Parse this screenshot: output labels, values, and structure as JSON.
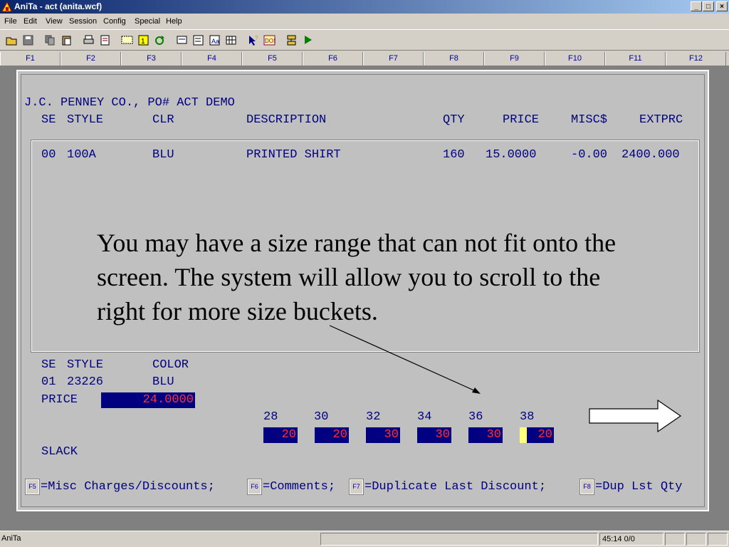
{
  "window": {
    "title": "AniTa - act (anita.wcf)",
    "controls": {
      "minimize": "_",
      "maximize": "□",
      "close": "×"
    }
  },
  "menu": [
    "File",
    "Edit",
    "View",
    "Session",
    "Config",
    "Special",
    "Help"
  ],
  "toolbar": {
    "buttons": [
      "open-icon",
      "save-icon",
      "copy-icon",
      "paste-icon",
      "print-icon",
      "print-setup-icon",
      "screen-icon",
      "capture-icon",
      "refresh-icon",
      "keyboard-icon",
      "terminal-icon",
      "font-icon",
      "grid-icon",
      "help-pointer-icon",
      "dos-icon",
      "transfer-icon",
      "run-icon"
    ]
  },
  "function_keys": [
    "F1",
    "F2",
    "F3",
    "F4",
    "F5",
    "F6",
    "F7",
    "F8",
    "F9",
    "F10",
    "F11",
    "F12"
  ],
  "terminal": {
    "header_line": "J.C. PENNEY CO., PO# ACT DEMO",
    "columns": {
      "se": "SE",
      "style": "STYLE",
      "clr": "CLR",
      "description": "DESCRIPTION",
      "qty": "QTY",
      "price": "PRICE",
      "misc": "MISC$",
      "extprc": "EXTPRC"
    },
    "rows": [
      {
        "se": "00",
        "style": "100A",
        "clr": "BLU",
        "description": "PRINTED SHIRT",
        "qty": "160",
        "price": "15.0000",
        "misc": "-0.00",
        "extprc": "2400.000"
      }
    ],
    "caption": "You may have a size range that can not fit onto the screen. The system will allow you to scroll to the right for more size buckets.",
    "entry": {
      "se_label": "SE",
      "style_label": "STYLE",
      "color_label": "COLOR",
      "se_value": "01",
      "style_value": "23226",
      "color_value": "BLU",
      "price_label": "PRICE",
      "price_value": "24.0000",
      "slack_label": "SLACK"
    },
    "sizes": [
      {
        "size": "28",
        "qty": "20"
      },
      {
        "size": "30",
        "qty": "20"
      },
      {
        "size": "32",
        "qty": "30"
      },
      {
        "size": "34",
        "qty": "30"
      },
      {
        "size": "36",
        "qty": "30"
      },
      {
        "size": "38",
        "qty": "20"
      }
    ],
    "hotkeys": [
      {
        "key": "F5",
        "text": "=Misc Charges/Discounts;"
      },
      {
        "key": "F6",
        "text": "=Comments;"
      },
      {
        "key": "F7",
        "text": "=Duplicate Last Discount;"
      },
      {
        "key": "F8",
        "text": "=Dup Lst Qty"
      }
    ]
  },
  "status": {
    "app_name": "AniTa",
    "position": "45:14 0/0"
  },
  "colors": {
    "terminal_text": "#000080",
    "field_background": "#000080",
    "field_text": "#ff3030",
    "cursor": "#ffff80"
  }
}
